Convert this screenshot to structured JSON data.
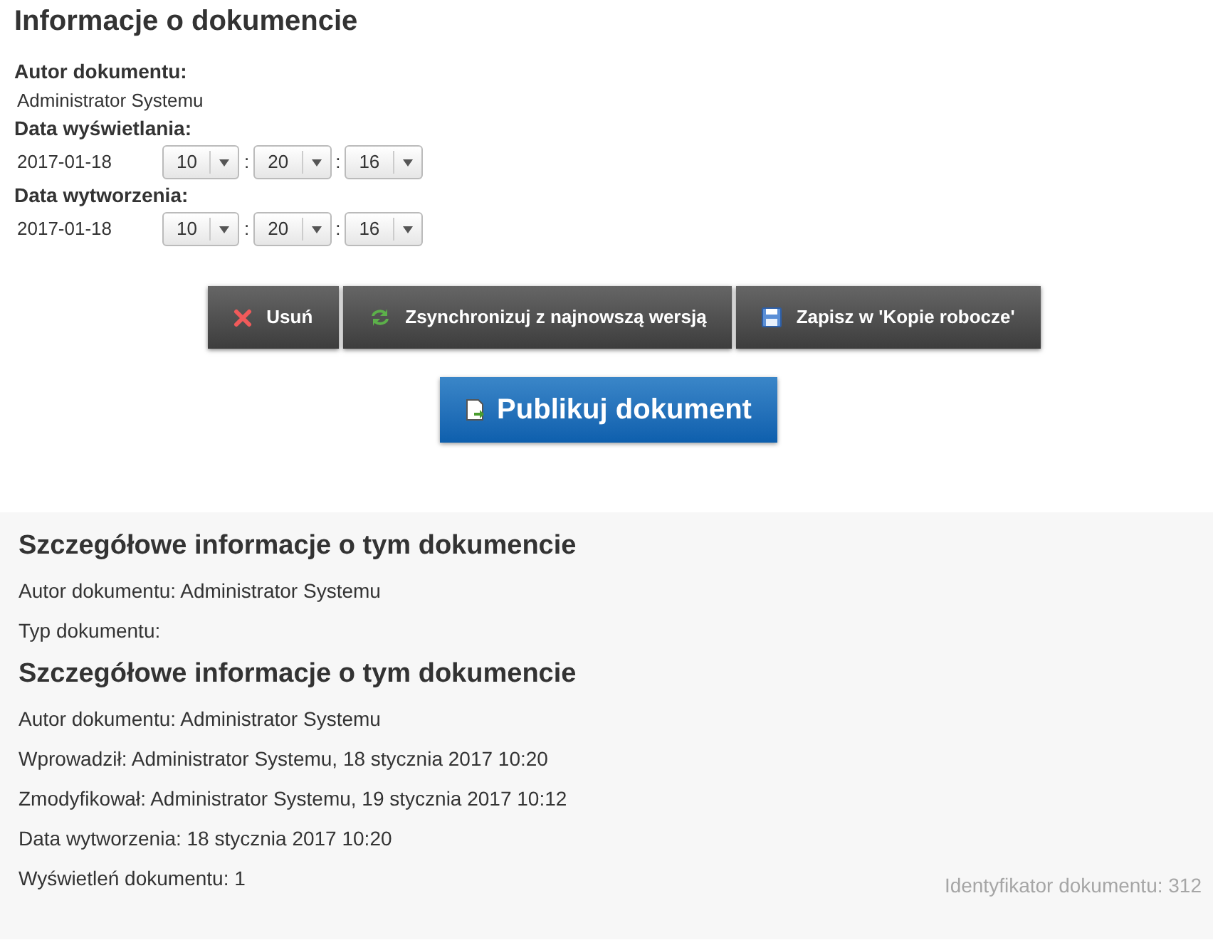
{
  "title": "Informacje o dokumencie",
  "author_label": "Autor dokumentu:",
  "author_value": "Administrator Systemu",
  "dates": [
    {
      "label": "Data wyświetlania:",
      "date": "2017-01-18",
      "hour": "10",
      "minute": "20",
      "second": "16",
      "sep1": ":",
      "sep2": ":"
    },
    {
      "label": "Data wytworzenia:",
      "date": "2017-01-18",
      "hour": "10",
      "minute": "20",
      "second": "16",
      "sep1": ":",
      "sep2": ":"
    }
  ],
  "actions": [
    {
      "kind": "delete",
      "label": "Usuń"
    },
    {
      "kind": "sync",
      "label": "Zsynchronizuj z najnowszą wersją"
    },
    {
      "kind": "save",
      "label": "Zapisz w 'Kopie robocze'"
    }
  ],
  "publish_button": "Publikuj dokument",
  "details": [
    {
      "kind": "heading",
      "text": "Szczegółowe informacje o tym dokumencie"
    },
    {
      "kind": "line",
      "text": "Autor dokumentu: Administrator Systemu"
    },
    {
      "kind": "line",
      "text": "Typ dokumentu:"
    },
    {
      "kind": "heading",
      "text": "Szczegółowe informacje o tym dokumencie"
    },
    {
      "kind": "line",
      "text": "Autor dokumentu: Administrator Systemu"
    },
    {
      "kind": "line",
      "text": "Wprowadził: Administrator Systemu, 18 stycznia 2017 10:20"
    },
    {
      "kind": "line",
      "text": "Zmodyfikował: Administrator Systemu, 19 stycznia 2017 10:12"
    },
    {
      "kind": "line",
      "text": "Data wytworzenia: 18 stycznia 2017 10:20"
    },
    {
      "kind": "line",
      "text": "Wyświetleń dokumentu: 1"
    }
  ],
  "document_id": "Identyfikator dokumentu: 312"
}
